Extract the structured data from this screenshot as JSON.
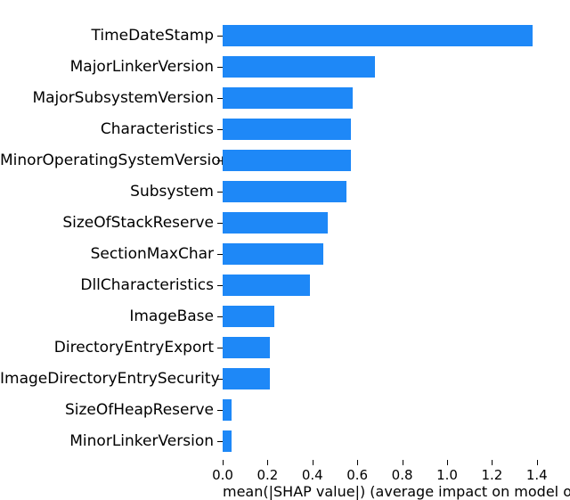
{
  "chart_data": {
    "type": "bar",
    "orientation": "horizontal",
    "categories": [
      "TimeDateStamp",
      "MajorLinkerVersion",
      "MajorSubsystemVersion",
      "Characteristics",
      "MinorOperatingSystemVersion",
      "Subsystem",
      "SizeOfStackReserve",
      "SectionMaxChar",
      "DllCharacteristics",
      "ImageBase",
      "DirectoryEntryExport",
      "ImageDirectoryEntrySecurity",
      "SizeOfHeapReserve",
      "MinorLinkerVersion"
    ],
    "values": [
      1.38,
      0.68,
      0.58,
      0.57,
      0.57,
      0.55,
      0.47,
      0.45,
      0.39,
      0.23,
      0.21,
      0.21,
      0.04,
      0.04
    ],
    "bar_color": "#1e88f7",
    "xlabel": "mean(|SHAP value|) (average impact on model output magnitude)",
    "ylabel": "",
    "xlim": [
      0.0,
      1.5
    ],
    "x_ticks": [
      0.0,
      0.2,
      0.4,
      0.6,
      0.8,
      1.0,
      1.2,
      1.4
    ],
    "title": ""
  }
}
